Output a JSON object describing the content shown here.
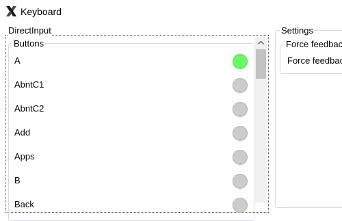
{
  "window": {
    "title": "Keyboard",
    "app_icon": "x-logo-icon"
  },
  "directinput": {
    "label": "DirectInput"
  },
  "buttons": {
    "label": "Buttons",
    "items": [
      {
        "label": "A",
        "pressed": true
      },
      {
        "label": "AbntC1",
        "pressed": false
      },
      {
        "label": "AbntC2",
        "pressed": false
      },
      {
        "label": "Add",
        "pressed": false
      },
      {
        "label": "Apps",
        "pressed": false
      },
      {
        "label": "B",
        "pressed": false
      },
      {
        "label": "Back",
        "pressed": false
      }
    ]
  },
  "settings": {
    "label": "Settings",
    "force_feedback": {
      "label": "Force feedback",
      "option_label": "Force feedback"
    }
  },
  "colors": {
    "pressed": "#66ff66",
    "released": "#cccccc",
    "frame": "#d5dbe3"
  }
}
